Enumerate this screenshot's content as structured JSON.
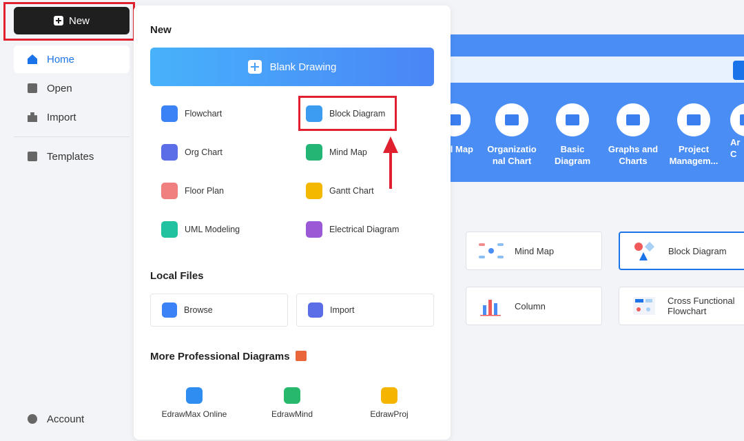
{
  "sidebar": {
    "new_label": "New",
    "items": [
      {
        "label": "Home"
      },
      {
        "label": "Open"
      },
      {
        "label": "Import"
      },
      {
        "label": "Templates"
      }
    ],
    "account_label": "Account"
  },
  "background": {
    "categories": [
      "l Map",
      "Organizatio nal Chart",
      "Basic Diagram",
      "Graphs and Charts",
      "Project Managem...",
      "Ar C"
    ],
    "cards": [
      {
        "label": "Mind Map"
      },
      {
        "label": "Block Diagram"
      },
      {
        "label": "Column"
      },
      {
        "label": "Cross Functional Flowchart"
      }
    ]
  },
  "panel": {
    "new_title": "New",
    "blank_drawing": "Blank Drawing",
    "types": [
      {
        "label": "Flowchart",
        "color": "#3b82f6"
      },
      {
        "label": "Block Diagram",
        "color": "#3b9cf0"
      },
      {
        "label": "Org Chart",
        "color": "#5b6ee8"
      },
      {
        "label": "Mind Map",
        "color": "#22b573"
      },
      {
        "label": "Floor Plan",
        "color": "#f08080"
      },
      {
        "label": "Gantt Chart",
        "color": "#f5b800"
      },
      {
        "label": "UML Modeling",
        "color": "#20c2a0"
      },
      {
        "label": "Electrical Diagram",
        "color": "#9b59d6"
      }
    ],
    "local_files_title": "Local Files",
    "browse_label": "Browse",
    "import_label": "Import",
    "more_title": "More Professional Diagrams",
    "products": [
      {
        "label": "EdrawMax Online",
        "color": "#2f8cf0"
      },
      {
        "label": "EdrawMind",
        "color": "#27b86b"
      },
      {
        "label": "EdrawProj",
        "color": "#f5b400"
      }
    ]
  },
  "colors": {
    "accent": "#1a73e8",
    "highlight_red": "#e0202e",
    "banner_blue": "#4a8ef5"
  }
}
